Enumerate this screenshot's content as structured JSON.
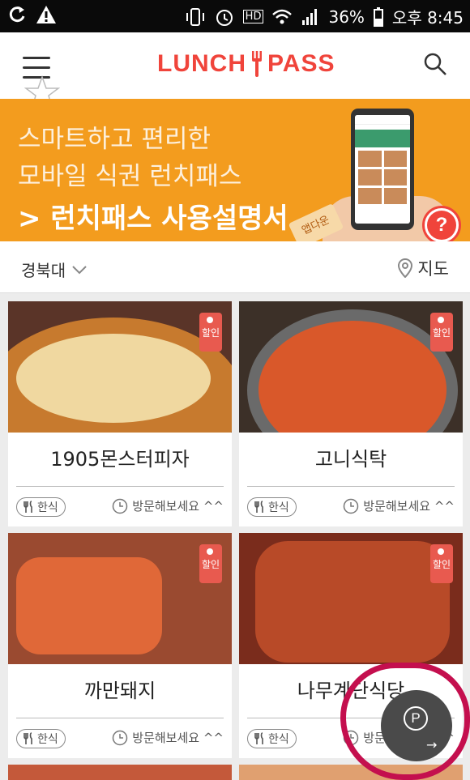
{
  "status_bar": {
    "battery": "36%",
    "time": "오후 8:45",
    "hd_label": "HD"
  },
  "header": {
    "logo_left": "LUNCH",
    "logo_right": "PASS"
  },
  "banner": {
    "line1": "스마트하고 편리한",
    "line2": "모바일 식권 런치패스",
    "cta": "> 런치패스 사용설명서",
    "tag": "앱다운",
    "help": "?",
    "page_count": 3,
    "active_page": 1
  },
  "location": {
    "name": "경북대",
    "map_label": "지도"
  },
  "cards": [
    {
      "name": "1905몬스터피자",
      "category": "한식",
      "visit": "방문해보세요 ^^",
      "sale": "할인"
    },
    {
      "name": "고니식탁",
      "category": "한식",
      "visit": "방문해보세요 ^^",
      "sale": "할인"
    },
    {
      "name": "까만돼지",
      "category": "한식",
      "visit": "방문해보세요 ^^",
      "sale": "할인"
    },
    {
      "name": "나무계단식당",
      "category": "한식",
      "visit": "방문해보세요 ^^",
      "sale": "할인"
    }
  ],
  "fab": {
    "label": "P"
  },
  "colors": {
    "brand": "#f0443b",
    "banner": "#f39c1e",
    "annotation": "#c40f4e"
  }
}
